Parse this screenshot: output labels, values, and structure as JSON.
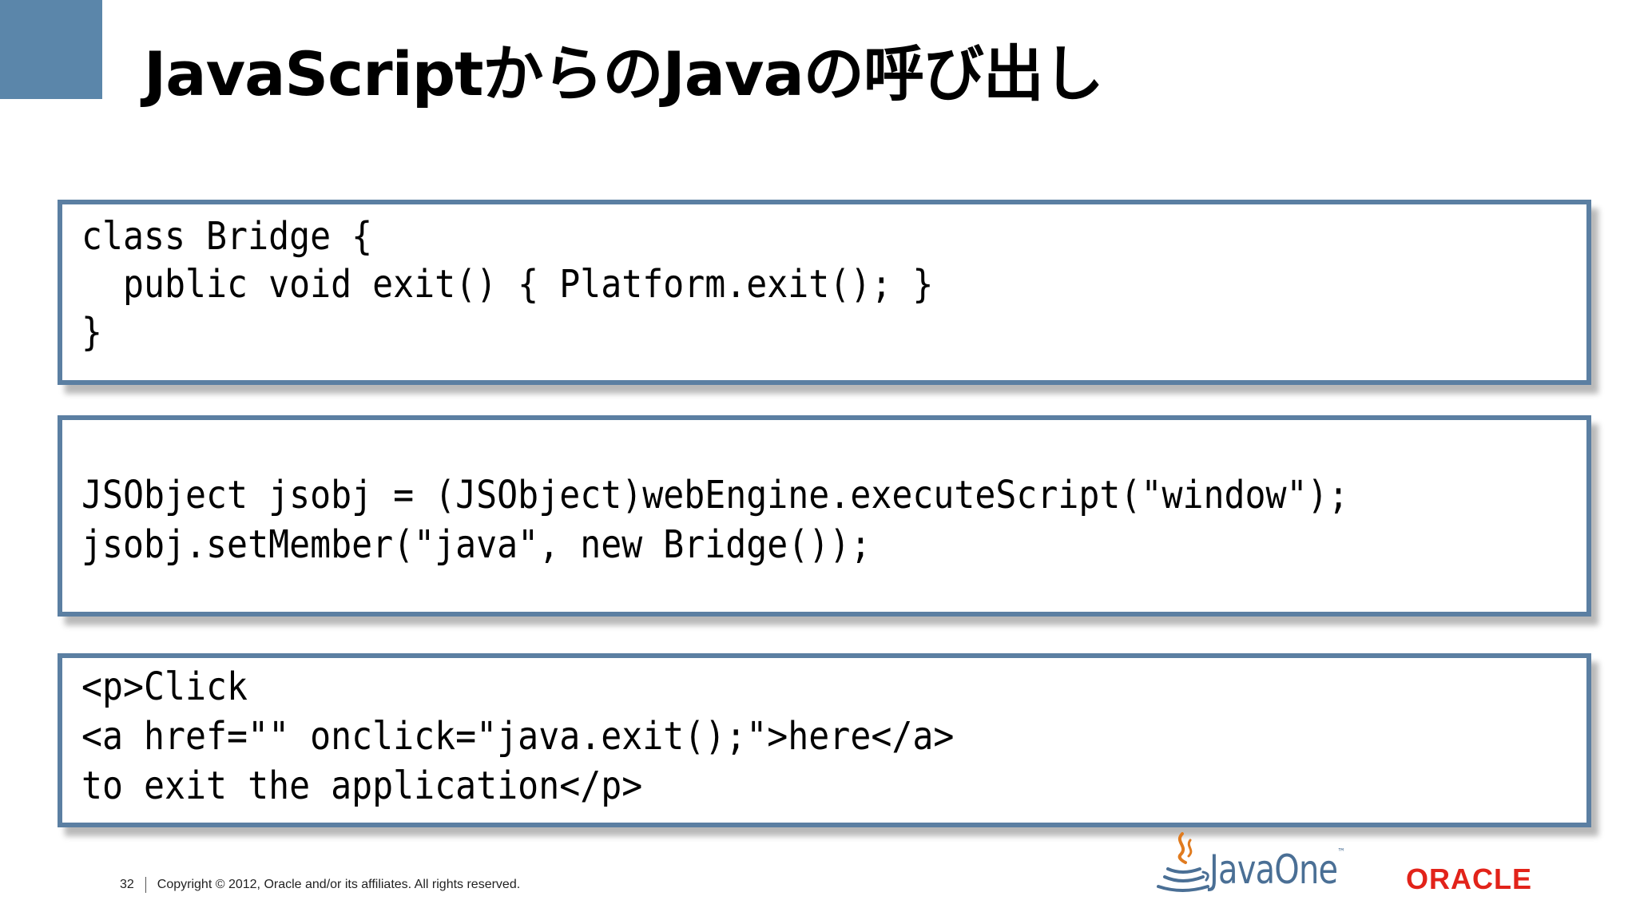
{
  "slide": {
    "title": "JavaScriptからのJavaの呼び出し"
  },
  "code_blocks": [
    {
      "lines": [
        "class Bridge {",
        "  public void exit() { Platform.exit(); }",
        "}"
      ]
    },
    {
      "lines": [
        "JSObject jsobj = (JSObject)webEngine.executeScript(\"window\");",
        "jsobj.setMember(\"java\", new Bridge());"
      ]
    },
    {
      "lines": [
        "<p>Click",
        "<a href=\"\" onclick=\"java.exit();\">here</a>",
        "to exit the application</p>"
      ]
    }
  ],
  "footer": {
    "page_number": "32",
    "copyright": "Copyright © 2012, Oracle and/or its affiliates. All rights reserved."
  },
  "logos": {
    "javaone": "JavaOne",
    "javaone_tm": "™",
    "oracle": "ORACLE"
  },
  "colors": {
    "accent": "#5b86aa",
    "box_border": "#5b7fa2",
    "oracle_red": "#e2231a"
  }
}
